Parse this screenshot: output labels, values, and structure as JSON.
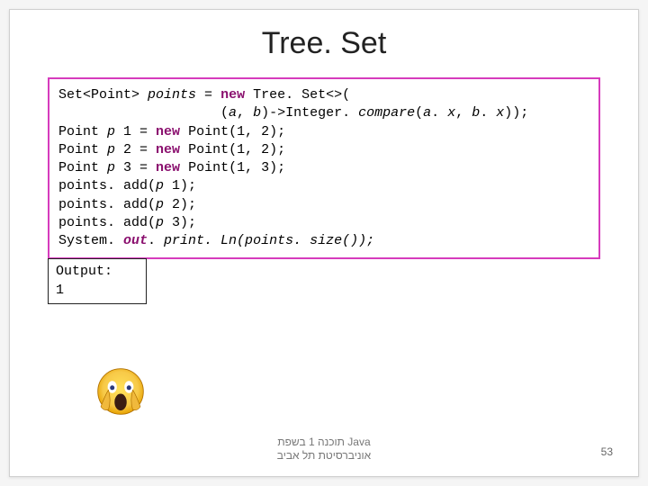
{
  "slide": {
    "title": "Tree. Set",
    "code_tokens": [
      {
        "t": "Set<Point> "
      },
      {
        "t": "points",
        "cls": "ital"
      },
      {
        "t": " = "
      },
      {
        "t": "new",
        "cls": "kw"
      },
      {
        "t": " Tree. Set<>(\n"
      },
      {
        "t": "                    ("
      },
      {
        "t": "a",
        "cls": "ital"
      },
      {
        "t": ", "
      },
      {
        "t": "b",
        "cls": "ital"
      },
      {
        "t": ")->Integer. "
      },
      {
        "t": "compare",
        "cls": "ital"
      },
      {
        "t": "("
      },
      {
        "t": "a",
        "cls": "ital"
      },
      {
        "t": ". "
      },
      {
        "t": "x",
        "cls": "ital"
      },
      {
        "t": ", "
      },
      {
        "t": "b",
        "cls": "ital"
      },
      {
        "t": ". "
      },
      {
        "t": "x",
        "cls": "ital"
      },
      {
        "t": "));\n"
      },
      {
        "t": "Point "
      },
      {
        "t": "p",
        "cls": "ital"
      },
      {
        "t": " 1 = "
      },
      {
        "t": "new",
        "cls": "kw"
      },
      {
        "t": " Point(1, 2);\n"
      },
      {
        "t": "Point "
      },
      {
        "t": "p",
        "cls": "ital"
      },
      {
        "t": " 2 = "
      },
      {
        "t": "new",
        "cls": "kw"
      },
      {
        "t": " Point(1, 2);\n"
      },
      {
        "t": "Point "
      },
      {
        "t": "p",
        "cls": "ital"
      },
      {
        "t": " 3 = "
      },
      {
        "t": "new",
        "cls": "kw"
      },
      {
        "t": " Point(1, 3);\n"
      },
      {
        "t": "points. add("
      },
      {
        "t": "p",
        "cls": "ital"
      },
      {
        "t": " 1);\n"
      },
      {
        "t": "points. add("
      },
      {
        "t": "p",
        "cls": "ital"
      },
      {
        "t": " 2);\n"
      },
      {
        "t": "points. add("
      },
      {
        "t": "p",
        "cls": "ital"
      },
      {
        "t": " 3);\n"
      },
      {
        "t": "System. "
      },
      {
        "t": "out",
        "cls": "ital kw"
      },
      {
        "t": ". "
      },
      {
        "t": "print. Ln(points. size());",
        "cls": "ital"
      }
    ],
    "output_label": "Output:",
    "output_value": "1",
    "footer_line1": "תוכנה 1 בשפת Java",
    "footer_line2": "אוניברסיטת תל אביב",
    "page_number": "53"
  }
}
